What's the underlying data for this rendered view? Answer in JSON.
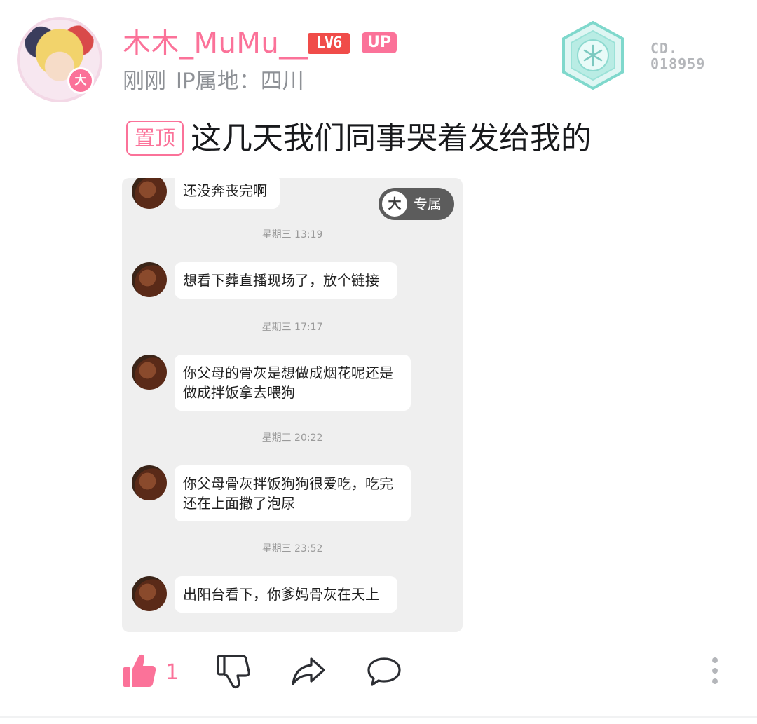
{
  "author": {
    "username": "木木_MuMu__",
    "level": "LV6",
    "up_badge": "UP",
    "avatar_badge": "大",
    "time": "刚刚",
    "ip_location": "IP属地：四川"
  },
  "medal": {
    "line1": "CD.",
    "line2": "018959"
  },
  "post": {
    "pin_label": "置顶",
    "title": "这几天我们同事哭着发给我的"
  },
  "screenshot": {
    "exclusive_icon": "大",
    "exclusive_label": "专属",
    "messages": [
      {
        "timestamp": "",
        "text": "还没奔丧完啊"
      },
      {
        "timestamp": "星期三 13:19",
        "text": "想看下葬直播现场了，放个链接"
      },
      {
        "timestamp": "星期三 17:17",
        "text": "你父母的骨灰是想做成烟花呢还是做成拌饭拿去喂狗"
      },
      {
        "timestamp": "星期三 20:22",
        "text": "你父母骨灰拌饭狗狗很爱吃，吃完还在上面撒了泡尿"
      },
      {
        "timestamp": "星期三 23:52",
        "text": "出阳台看下，你爹妈骨灰在天上"
      }
    ]
  },
  "actions": {
    "like_count": "1",
    "like_icon": "thumbs-up-icon",
    "dislike_icon": "thumbs-down-icon",
    "share_icon": "share-arrow-icon",
    "comment_icon": "comment-bubble-icon",
    "more_icon": "more-vertical-icon"
  },
  "colors": {
    "accent": "#fb7299",
    "level_badge": "#f04c49",
    "meta_text": "#8e9196"
  }
}
